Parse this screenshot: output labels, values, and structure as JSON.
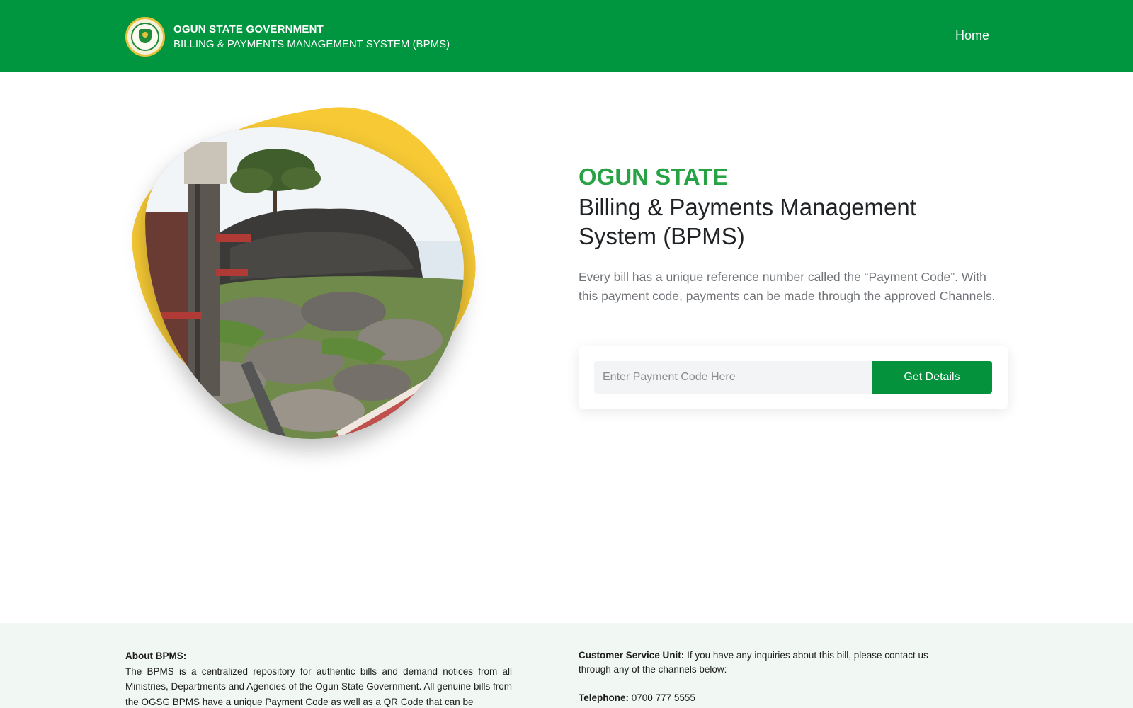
{
  "header": {
    "org_name": "OGUN STATE GOVERNMENT",
    "system_name": "BILLING & PAYMENTS MANAGEMENT SYSTEM (BPMS)",
    "nav_home": "Home"
  },
  "hero": {
    "kicker": "OGUN STATE",
    "title_line1": "Billing & Payments Management",
    "title_line2": "System (BPMS)",
    "description": "Every bill has a unique reference number called the “Payment Code”. With this payment code, payments can be made through the approved Channels."
  },
  "search": {
    "placeholder": "Enter Payment Code Here",
    "button_label": "Get Details"
  },
  "footer": {
    "about_heading": "About BPMS:",
    "about_text": "The BPMS is a centralized repository for authentic bills and demand notices from all Ministries, Departments and Agencies of the Ogun State Government. All genuine bills from the OGSG BPMS have a unique Payment Code as well as a QR Code that can be",
    "contact_heading": "Customer Service Unit:",
    "contact_text": "If you have any inquiries about this bill, please contact us through any of the channels below:",
    "telephone_label": "Telephone:",
    "telephone_value": "0700 777 5555"
  },
  "colors": {
    "brand_green": "#00963F",
    "accent_green": "#27A345",
    "button_green": "#04933C",
    "blob_yellow": "#F6C935",
    "footer_bg": "#F1F8F3"
  }
}
